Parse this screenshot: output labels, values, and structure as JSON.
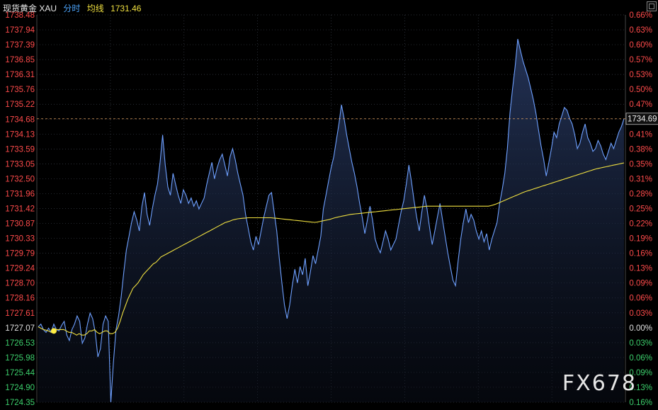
{
  "header": {
    "title": "现货黄金 XAU",
    "mode": "分时",
    "avg_label": "均线",
    "avg_value": "1731.46"
  },
  "colors": {
    "background": "#000000",
    "grid": "#3a3f4a",
    "price_line": "#6ea0ff",
    "avg_line": "#f0e040",
    "up": "#ff4b4b",
    "down": "#3cd06c",
    "neutral": "#e0e0e0",
    "ref_line": "#e0a060"
  },
  "current_price_tag": "1734.69",
  "watermark": "FX678",
  "chart_data": {
    "type": "line",
    "title": "",
    "ylim": [
      1724.35,
      1738.48
    ],
    "yticks_left": [
      "1738.48",
      "1737.94",
      "1737.39",
      "1736.85",
      "1736.31",
      "1735.76",
      "1735.22",
      "1734.68",
      "1734.13",
      "1733.59",
      "1733.05",
      "1732.50",
      "1731.96",
      "1731.42",
      "1730.87",
      "1730.33",
      "1729.79",
      "1729.24",
      "1728.70",
      "1728.16",
      "1727.61",
      "1727.07",
      "1726.53",
      "1725.98",
      "1725.44",
      "1724.90",
      "1724.35"
    ],
    "yticks_right": [
      "0.66%",
      "0.63%",
      "0.60%",
      "0.57%",
      "0.53%",
      "0.50%",
      "0.47%",
      "0.44%",
      "0.41%",
      "0.38%",
      "0.35%",
      "0.31%",
      "0.28%",
      "0.25%",
      "0.22%",
      "0.19%",
      "0.16%",
      "0.13%",
      "0.09%",
      "0.06%",
      "0.03%",
      "0.00%",
      "0.03%",
      "0.06%",
      "0.09%",
      "0.13%",
      "0.16%"
    ],
    "base_index": 21,
    "reference_price": 1734.69,
    "series": [
      {
        "values": [
          1727.1,
          1727.2,
          1727.0,
          1726.9,
          1727.05,
          1726.9,
          1727.2,
          1727.0,
          1726.95,
          1727.15,
          1727.3,
          1726.8,
          1726.6,
          1727.0,
          1727.2,
          1727.5,
          1727.3,
          1726.5,
          1726.7,
          1727.2,
          1727.6,
          1727.4,
          1726.9,
          1726.0,
          1726.3,
          1727.2,
          1727.5,
          1727.3,
          1724.35,
          1725.8,
          1727.0,
          1727.5,
          1728.2,
          1729.1,
          1729.9,
          1730.4,
          1730.9,
          1731.3,
          1731.0,
          1730.6,
          1731.5,
          1732.0,
          1731.2,
          1730.8,
          1731.4,
          1731.9,
          1732.3,
          1733.1,
          1734.1,
          1733.0,
          1732.2,
          1731.9,
          1732.7,
          1732.3,
          1731.9,
          1731.6,
          1732.1,
          1731.9,
          1731.6,
          1731.8,
          1731.5,
          1731.7,
          1731.4,
          1731.6,
          1731.8,
          1732.3,
          1732.7,
          1733.1,
          1732.5,
          1732.9,
          1733.2,
          1733.4,
          1733.0,
          1732.6,
          1733.3,
          1733.6,
          1733.2,
          1732.7,
          1732.3,
          1731.9,
          1731.2,
          1730.7,
          1730.2,
          1729.9,
          1730.4,
          1730.1,
          1730.6,
          1731.1,
          1731.5,
          1731.9,
          1732.0,
          1731.3,
          1730.6,
          1729.6,
          1728.7,
          1727.9,
          1727.4,
          1727.9,
          1728.6,
          1729.2,
          1728.7,
          1729.3,
          1729.0,
          1729.6,
          1728.6,
          1729.1,
          1729.7,
          1729.4,
          1729.9,
          1730.4,
          1731.4,
          1731.9,
          1732.4,
          1732.9,
          1733.3,
          1733.9,
          1734.5,
          1735.2,
          1734.7,
          1734.1,
          1733.6,
          1733.1,
          1732.7,
          1732.2,
          1731.6,
          1731.1,
          1730.5,
          1731.0,
          1731.5,
          1731.0,
          1730.3,
          1730.0,
          1729.8,
          1730.2,
          1730.6,
          1730.3,
          1729.9,
          1730.1,
          1730.3,
          1730.8,
          1731.3,
          1731.7,
          1732.3,
          1733.0,
          1732.4,
          1731.7,
          1731.1,
          1730.6,
          1731.3,
          1731.9,
          1731.4,
          1730.7,
          1730.1,
          1730.6,
          1731.1,
          1731.6,
          1731.0,
          1730.4,
          1729.8,
          1729.3,
          1728.8,
          1728.6,
          1729.5,
          1730.3,
          1730.9,
          1731.4,
          1730.9,
          1731.2,
          1731.0,
          1730.6,
          1730.3,
          1730.6,
          1730.2,
          1730.5,
          1729.9,
          1730.3,
          1730.6,
          1730.9,
          1731.6,
          1732.1,
          1732.7,
          1733.6,
          1734.9,
          1735.8,
          1736.6,
          1737.6,
          1737.2,
          1736.8,
          1736.5,
          1736.2,
          1735.8,
          1735.4,
          1734.9,
          1734.3,
          1733.7,
          1733.2,
          1732.6,
          1733.1,
          1733.6,
          1734.2,
          1734.0,
          1734.5,
          1734.8,
          1735.1,
          1735.0,
          1734.7,
          1734.5,
          1734.1,
          1733.6,
          1733.8,
          1734.2,
          1734.5,
          1734.0,
          1733.8,
          1733.5,
          1733.6,
          1733.9,
          1733.7,
          1733.4,
          1733.2,
          1733.5,
          1733.8,
          1733.6,
          1733.9,
          1734.2,
          1734.4,
          1734.69
        ]
      },
      {
        "values": [
          1727.1,
          1727.05,
          1727.0,
          1726.98,
          1726.95,
          1726.9,
          1726.95,
          1727.0,
          1727.0,
          1727.0,
          1727.0,
          1726.95,
          1726.9,
          1726.9,
          1726.85,
          1726.8,
          1726.85,
          1726.8,
          1726.8,
          1726.85,
          1726.95,
          1726.95,
          1727.0,
          1726.9,
          1726.85,
          1726.9,
          1726.95,
          1726.95,
          1726.85,
          1726.85,
          1726.9,
          1727.05,
          1727.3,
          1727.6,
          1727.85,
          1728.1,
          1728.3,
          1728.5,
          1728.6,
          1728.7,
          1728.85,
          1729.0,
          1729.1,
          1729.2,
          1729.3,
          1729.4,
          1729.45,
          1729.55,
          1729.65,
          1729.7,
          1729.75,
          1729.8,
          1729.85,
          1729.9,
          1729.95,
          1730.0,
          1730.05,
          1730.1,
          1730.15,
          1730.2,
          1730.25,
          1730.3,
          1730.35,
          1730.4,
          1730.45,
          1730.5,
          1730.55,
          1730.6,
          1730.65,
          1730.7,
          1730.75,
          1730.8,
          1730.85,
          1730.9,
          1730.93,
          1730.96,
          1731.0,
          1731.02,
          1731.04,
          1731.05,
          1731.06,
          1731.07,
          1731.08,
          1731.08,
          1731.08,
          1731.08,
          1731.08,
          1731.08,
          1731.08,
          1731.08,
          1731.08,
          1731.08,
          1731.07,
          1731.06,
          1731.05,
          1731.04,
          1731.03,
          1731.02,
          1731.01,
          1731.0,
          1730.99,
          1730.98,
          1730.97,
          1730.96,
          1730.95,
          1730.94,
          1730.93,
          1730.92,
          1730.91,
          1730.92,
          1730.94,
          1730.96,
          1730.98,
          1731.0,
          1731.02,
          1731.05,
          1731.08,
          1731.1,
          1731.12,
          1731.14,
          1731.16,
          1731.18,
          1731.2,
          1731.21,
          1731.22,
          1731.23,
          1731.24,
          1731.25,
          1731.26,
          1731.27,
          1731.28,
          1731.29,
          1731.3,
          1731.31,
          1731.32,
          1731.33,
          1731.34,
          1731.35,
          1731.36,
          1731.37,
          1731.38,
          1731.39,
          1731.4,
          1731.41,
          1731.42,
          1731.43,
          1731.44,
          1731.45,
          1731.46,
          1731.47,
          1731.48,
          1731.49,
          1731.5,
          1731.5,
          1731.5,
          1731.5,
          1731.5,
          1731.5,
          1731.5,
          1731.5,
          1731.5,
          1731.5,
          1731.5,
          1731.5,
          1731.5,
          1731.5,
          1731.5,
          1731.5,
          1731.5,
          1731.5,
          1731.5,
          1731.5,
          1731.5,
          1731.5,
          1731.5,
          1731.5,
          1731.5,
          1731.52,
          1731.55,
          1731.58,
          1731.62,
          1731.66,
          1731.7,
          1731.74,
          1731.78,
          1731.82,
          1731.86,
          1731.9,
          1731.94,
          1731.98,
          1732.02,
          1732.05,
          1732.08,
          1732.11,
          1732.14,
          1732.17,
          1732.2,
          1732.23,
          1732.26,
          1732.29,
          1732.32,
          1732.35,
          1732.38,
          1732.41,
          1732.44,
          1732.47,
          1732.5,
          1732.53,
          1732.56,
          1732.59,
          1732.62,
          1732.65,
          1732.68,
          1732.71,
          1732.74,
          1732.77,
          1732.8,
          1732.83,
          1732.86,
          1732.88,
          1732.9,
          1732.92,
          1732.94,
          1732.96,
          1732.98,
          1733.0,
          1733.02,
          1733.04,
          1733.06,
          1733.08
        ]
      }
    ]
  }
}
